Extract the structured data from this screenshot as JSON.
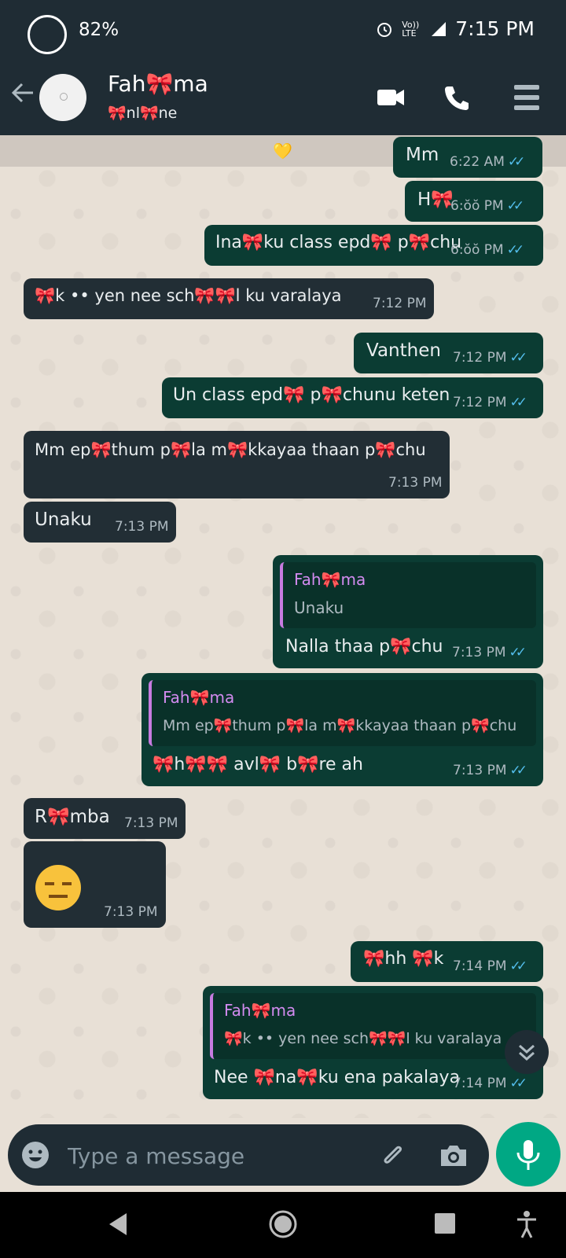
{
  "status_bar": {
    "battery": "82%",
    "time": "7:15 PM",
    "volte_label": "Vo)) LTE",
    "lte_label": "LTE"
  },
  "header": {
    "name": "Fah🎀ma",
    "status": "🎀nl🎀ne"
  },
  "banner": {
    "emoji": "💛"
  },
  "messages": [
    {
      "dir": "out",
      "text": "Mm",
      "time": "6:22 AM",
      "ticks": "✓✓"
    },
    {
      "dir": "out",
      "text": "H🎀",
      "time": "6:ŏŏ PM",
      "ticks": "✓✓"
    },
    {
      "dir": "out",
      "text": "Ina🎀ku class epd🎀 p🎀chu",
      "time": "6:ŏŏ PM",
      "ticks": "✓✓"
    },
    {
      "dir": "in",
      "text": "🎀k •• yen nee sch🎀🎀l ku varalaya",
      "time": "7:12 PM"
    },
    {
      "dir": "out",
      "text": "Vanthen",
      "time": "7:12 PM",
      "ticks": "✓✓"
    },
    {
      "dir": "out",
      "text": "Un class epd🎀 p🎀chunu keten",
      "time": "7:12 PM",
      "ticks": "✓✓"
    },
    {
      "dir": "in",
      "text": "Mm ep🎀thum p🎀la  m🎀kkayaa thaan p🎀chu",
      "time": "7:13 PM"
    },
    {
      "dir": "in",
      "text": "Unaku",
      "time": "7:13 PM"
    },
    {
      "dir": "out",
      "quote_name": "Fah🎀ma",
      "quote_text": "Unaku",
      "text": "Nalla thaa p🎀chu",
      "time": "7:13 PM",
      "ticks": "✓✓"
    },
    {
      "dir": "out",
      "quote_name": "Fah🎀ma",
      "quote_text": "Mm ep🎀thum p🎀la  m🎀kkayaa thaan p🎀chu",
      "text": "🎀h🎀🎀 avl🎀 b🎀re ah",
      "time": "7:13 PM",
      "ticks": "✓✓"
    },
    {
      "dir": "in",
      "text": "R🎀mba",
      "time": "7:13 PM"
    },
    {
      "dir": "in",
      "emoji": "expressionless-face",
      "time": "7:13 PM"
    },
    {
      "dir": "out",
      "text": "🎀hh 🎀k",
      "time": "7:14 PM",
      "ticks": "✓✓"
    },
    {
      "dir": "out",
      "quote_name": "Fah🎀ma",
      "quote_text": "🎀k •• yen nee sch🎀🎀l ku varalaya",
      "text": "Nee 🎀na🎀ku ena pakalaya",
      "time": "7:14 PM",
      "ticks": "✓✓"
    }
  ],
  "input": {
    "placeholder": "Type a message"
  },
  "colors": {
    "header_bg": "#1f2c34",
    "outgoing_bubble": "#0b3c33",
    "incoming_bubble": "#222e35",
    "accent": "#00a884",
    "tick_blue": "#53bdeb"
  }
}
